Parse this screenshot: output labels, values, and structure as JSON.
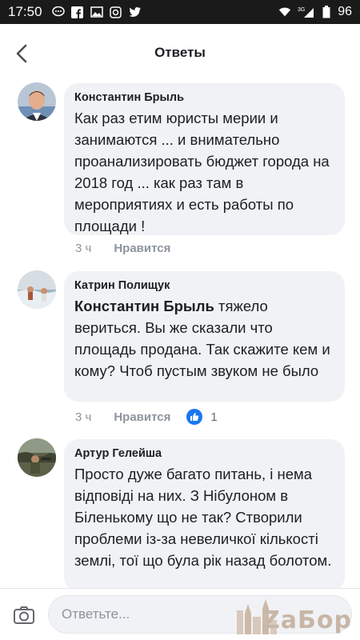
{
  "status_bar": {
    "time": "17:50",
    "network": "3G",
    "battery": "96"
  },
  "header": {
    "title": "Ответы"
  },
  "comments": [
    {
      "author": "Константин Брыль",
      "text": "Как раз етим юристы мерии и занимаются ... и внимательно проанализировать бюджет города на 2018 год ... как раз там в мероприятиях и есть работы по площади !",
      "time": "3 ч",
      "like_label": "Нравится"
    },
    {
      "author": "Катрин Полищук",
      "mention": "Константин Брыль",
      "text": " тяжело вериться. Вы же сказали что площадь продана. Так скажите кем и кому? Чтоб пустым звуком не было",
      "time": "3 ч",
      "like_label": "Нравится",
      "reactions_count": "1"
    },
    {
      "author": "Артур Гелейша",
      "text": "Просто дуже багато питань, і нема відповіді на них. З Нібулоном в Біленькому що не так? Створили проблеми із-за невеличкої кількості землі, тої що була рік назад болотом.",
      "time": "",
      "like_label": ""
    }
  ],
  "reply": {
    "placeholder": "Ответьте..."
  },
  "watermark": {
    "text": "ZaБор"
  },
  "colors": {
    "accent": "#1877f2",
    "bubble": "#f0f2f5",
    "meta": "#8d949e"
  }
}
